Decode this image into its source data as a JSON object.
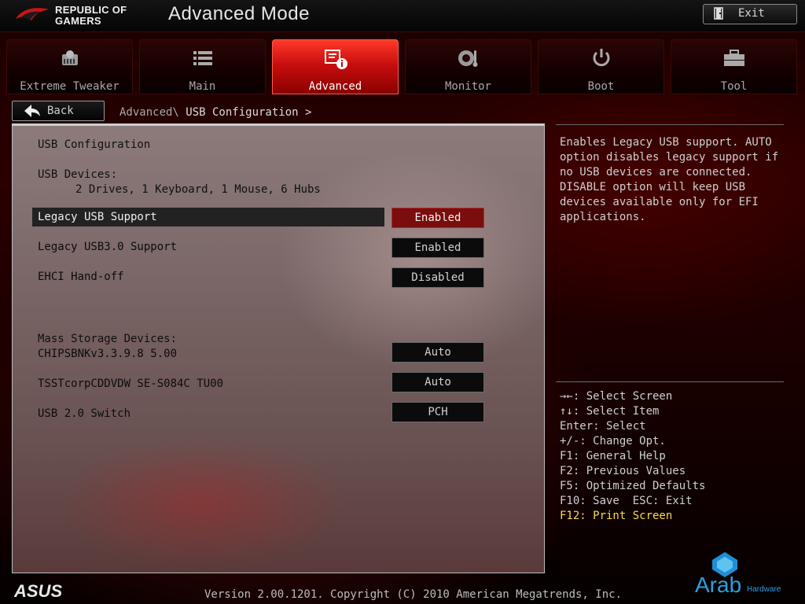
{
  "header": {
    "brand_line1": "REPUBLIC OF",
    "brand_line2": "GAMERS",
    "title": "Advanced Mode",
    "exit_label": "Exit"
  },
  "tabs": [
    {
      "label": "Extreme Tweaker",
      "icon": "tweaker-icon",
      "active": false
    },
    {
      "label": "Main",
      "icon": "list-icon",
      "active": false
    },
    {
      "label": "Advanced",
      "icon": "advanced-info-icon",
      "active": true
    },
    {
      "label": "Monitor",
      "icon": "gauge-icon",
      "active": false
    },
    {
      "label": "Boot",
      "icon": "power-icon",
      "active": false
    },
    {
      "label": "Tool",
      "icon": "toolbox-icon",
      "active": false
    }
  ],
  "breadcrumb": {
    "back_label": "Back",
    "parent": "Advanced\\",
    "current": " USB Configuration >"
  },
  "panel": {
    "section_title": "USB Configuration",
    "devices_label": "USB Devices:",
    "devices_value": "2 Drives, 1 Keyboard, 1 Mouse, 6 Hubs",
    "mass_storage_label": "Mass Storage Devices:",
    "settings": [
      {
        "label": "Legacy USB Support",
        "value": "Enabled",
        "selected": true
      },
      {
        "label": "Legacy USB3.0 Support",
        "value": "Enabled",
        "selected": false
      },
      {
        "label": "EHCI Hand-off",
        "value": "Disabled",
        "selected": false
      },
      {
        "label": "CHIPSBNKv3.3.9.8 5.00",
        "value": "Auto",
        "selected": false
      },
      {
        "label": "TSSTcorpCDDVDW SE-S084C TU00",
        "value": "Auto",
        "selected": false
      },
      {
        "label": "USB 2.0 Switch",
        "value": "PCH",
        "selected": false
      }
    ]
  },
  "help": {
    "text": "Enables Legacy USB support. AUTO option disables legacy support if no USB devices are connected. DISABLE option will keep USB devices available only for EFI applications."
  },
  "keys": [
    "→←: Select Screen",
    "↑↓: Select Item",
    "Enter: Select",
    "+/-: Change Opt.",
    "F1: General Help",
    "F2: Previous Values",
    "F5: Optimized Defaults",
    "F10: Save  ESC: Exit",
    "F12: Print Screen"
  ],
  "footer": {
    "brand": "ASUS",
    "version": "Version 2.00.1201. Copyright (C) 2010 American Megatrends, Inc.",
    "watermark": "Arab",
    "watermark_sub": "Hardware"
  },
  "colors": {
    "accent_red": "#c80e0e",
    "highlight_yellow": "#ffd84a"
  }
}
